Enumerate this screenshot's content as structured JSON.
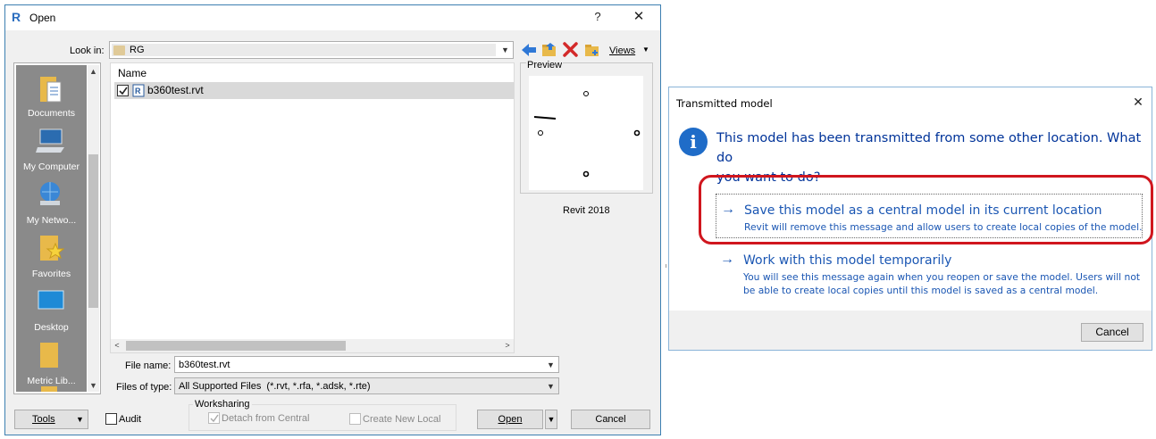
{
  "open_dialog": {
    "title": "Open",
    "help_glyph": "?",
    "close_glyph": "✕",
    "look_in_label": "Look in:",
    "look_in_value": "RG",
    "views_label": "Views",
    "toolbar_icons": [
      "back-arrow-icon",
      "folder-up-icon",
      "delete-icon",
      "new-folder-icon"
    ],
    "places": [
      {
        "label": "Documents",
        "icon": "documents-icon"
      },
      {
        "label": "My Computer",
        "icon": "computer-icon"
      },
      {
        "label": "My Netwo...",
        "icon": "network-icon"
      },
      {
        "label": "Favorites",
        "icon": "favorites-icon"
      },
      {
        "label": "Desktop",
        "icon": "desktop-icon"
      },
      {
        "label": "Metric Lib...",
        "icon": "folder-icon"
      }
    ],
    "list_header": "Name",
    "files": [
      {
        "name": "b360test.rvt",
        "checked": true
      }
    ],
    "preview_label": "Preview",
    "version_label": "Revit 2018",
    "file_name_label": "File name:",
    "file_name_value": "b360test.rvt",
    "files_of_type_label": "Files of type:",
    "files_of_type_value": "All Supported Files  (*.rvt, *.rfa, *.adsk, *.rte)",
    "tools_label": "Tools",
    "audit_label": "Audit",
    "worksharing_label": "Worksharing",
    "detach_label": "Detach from Central",
    "create_local_label": "Create New Local",
    "open_label": "Open",
    "cancel_label": "Cancel"
  },
  "transmitted_dialog": {
    "title": "Transmitted model",
    "close_glyph": "✕",
    "info_glyph": "i",
    "message_line1": "This model has been transmitted from some other location. What do",
    "message_line2": "you want to do?",
    "options": [
      {
        "arrow": "→",
        "heading": "Save this model as a central model in its current location",
        "detail_lines": [
          "Revit will remove this message and allow users to create local copies of the model."
        ],
        "highlighted": true
      },
      {
        "arrow": "→",
        "heading": "Work with this model temporarily",
        "detail_lines": [
          "You will see this message again when you reopen or save the model. Users will not",
          "be able to create local copies until this model is saved as a central model."
        ],
        "highlighted": false
      }
    ],
    "cancel_label": "Cancel"
  },
  "colors": {
    "dialog_bg": "#f0f0f0",
    "places_bg": "#8a8a8a",
    "link_blue": "#1a56b3",
    "info_blue": "#1f6cc8",
    "highlight_red": "#d0161e"
  }
}
